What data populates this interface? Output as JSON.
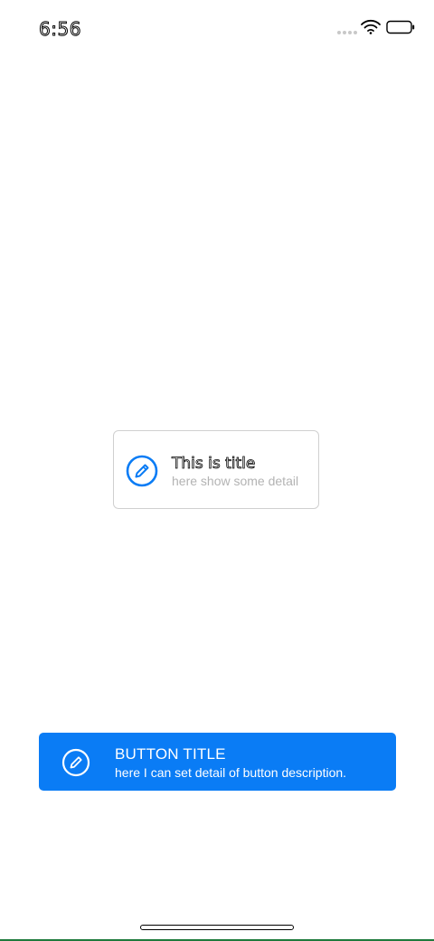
{
  "status_bar": {
    "time": "6:56"
  },
  "card_button": {
    "title": "This is title",
    "detail": "here show some detail",
    "icon": "pencil-circle-icon",
    "accent_color": "#0a7cf5"
  },
  "primary_button": {
    "title": "BUTTON TITLE",
    "detail": "here I can set detail of button description.",
    "icon": "pencil-circle-icon",
    "background_color": "#0a7cf5"
  }
}
